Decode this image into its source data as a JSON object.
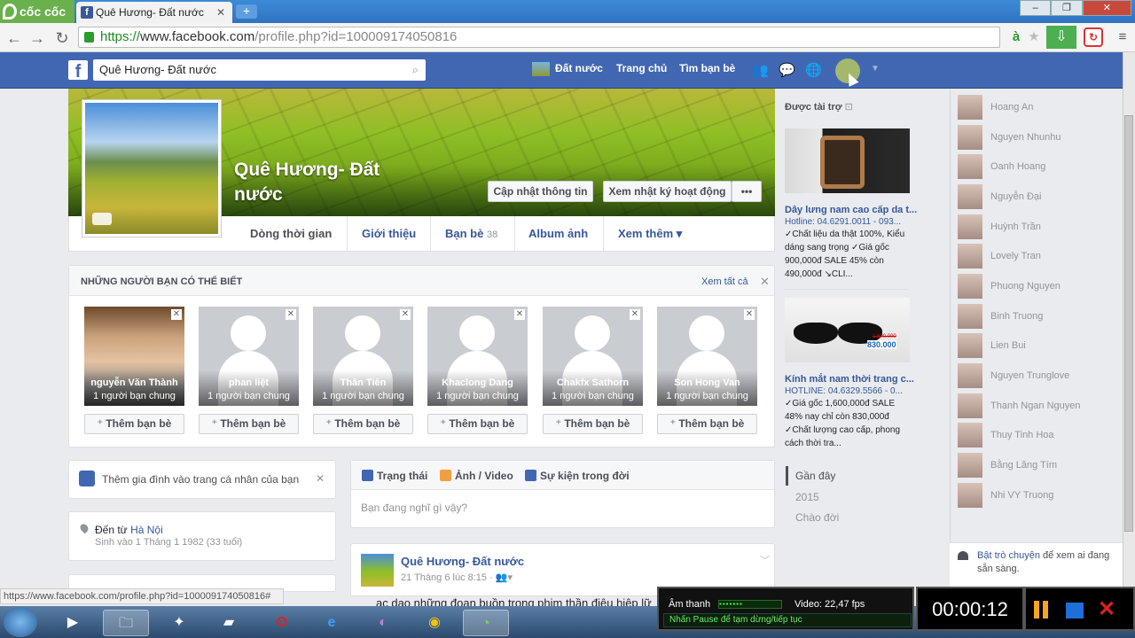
{
  "browser": {
    "brand": "cốc cốc",
    "tab_title": "Quê Hương- Đất nước",
    "url_https": "https://",
    "url_host": "www.facebook.com",
    "url_path": "/profile.php?id=100009174050816"
  },
  "fb": {
    "search_value": "Quê Hương- Đất nước",
    "nav_profile": "Đất nước",
    "nav_home": "Trang chủ",
    "nav_find": "Tìm bạn bè"
  },
  "profile": {
    "name": "Quê Hương- Đất nước",
    "update_info": "Cập nhật thông tin",
    "activity_log": "Xem nhật ký hoạt động",
    "more_dots": "•••",
    "tabs": [
      {
        "label": "Dòng thời gian"
      },
      {
        "label": "Giới thiệu"
      },
      {
        "label": "Bạn bè",
        "count": "38"
      },
      {
        "label": "Album ảnh"
      },
      {
        "label": "Xem thêm ▾"
      }
    ]
  },
  "pymk": {
    "title": "NHỮNG NGƯỜI BẠN CÓ THỂ BIẾT",
    "see_all": "Xem tất cả",
    "add_label": "Thêm bạn bè",
    "people": [
      {
        "name": "nguyễn Văn Thành",
        "mutual": "1 người bạn chung"
      },
      {
        "name": "phan liệt",
        "mutual": "1 người bạn chung"
      },
      {
        "name": "Thân Tiên",
        "mutual": "1 người bạn chung"
      },
      {
        "name": "Khaclong Dang",
        "mutual": "1 người bạn chung"
      },
      {
        "name": "Chakfx Sathorn",
        "mutual": "1 người bạn chung"
      },
      {
        "name": "Son Hong Van",
        "mutual": "1 người bạn chung"
      }
    ]
  },
  "left": {
    "family": "Thêm gia đình vào trang cá nhân của bạn",
    "from_prefix": "Đến từ ",
    "from_city": "Hà Nội",
    "born": "Sinh vào 1 Tháng 1 1982 (33 tuổi)"
  },
  "composer": {
    "status": "Trạng thái",
    "photo": "Ảnh / Video",
    "event": "Sự kiện trong đời",
    "placeholder": "Bạn đang nghĩ gì vậy?"
  },
  "post": {
    "author": "Quê Hương- Đất nước",
    "date": "21 Tháng 6 lúc 8:15 · ",
    "text": "ạc dạo những đoạn buồn trong phim thần điêu hiệp lữ"
  },
  "sponsored": {
    "heading": "Được tài trợ",
    "ads": [
      {
        "title": "Dây lưng nam cao cấp da t...",
        "hotline": "Hotline: 04.6291.0011 - 093...",
        "lines": [
          "✓Chất liệu da thật 100%, Kiểu",
          "dáng sang trọng ✓Giá gốc",
          "900,000đ SALE 45% còn",
          "490,000đ ↘CLI..."
        ]
      },
      {
        "title": "Kính mắt nam thời trang c...",
        "hotline": "HOTLINE: 04.6329.5566 - 0...",
        "price_old": "1.600.000",
        "price_new": "830.000",
        "lines": [
          "✓Giá gốc 1,600,000đ SALE",
          "48% nay chỉ còn 830,000đ",
          "✓Chất lượng cao cấp, phong",
          "cách thời tra..."
        ]
      }
    ]
  },
  "timeline_nav": [
    "Gần đây",
    "2015",
    "Chào đời"
  ],
  "chat": {
    "contacts": [
      "Hoang An",
      "Nguyen Nhunhu",
      "Oanh Hoang",
      "Nguyễn Đại",
      "Huỳnh Trần",
      "Lovely Tran",
      "Phuong Nguyen",
      "Binh Truong",
      "Lien Bui",
      "Nguyen Trunglove",
      "Thanh Ngan Nguyen",
      "Thuy Tinh Hoa",
      "Bằng Lăng Tím",
      "Nhi VY Truong"
    ],
    "footer_a": "Bật trò chuyện",
    "footer_b": " để xem ai đang sẵn sàng."
  },
  "status_url": "https://www.facebook.com/profile.php?id=100009174050816#",
  "recorder": {
    "audio": "Âm thanh",
    "meter": "▪▪▪▪▪▪▪",
    "video": "Video: 22,47 fps",
    "hint": "Nhấn Pause để tạm dừng/tiếp tục",
    "time": "00:00:12"
  }
}
